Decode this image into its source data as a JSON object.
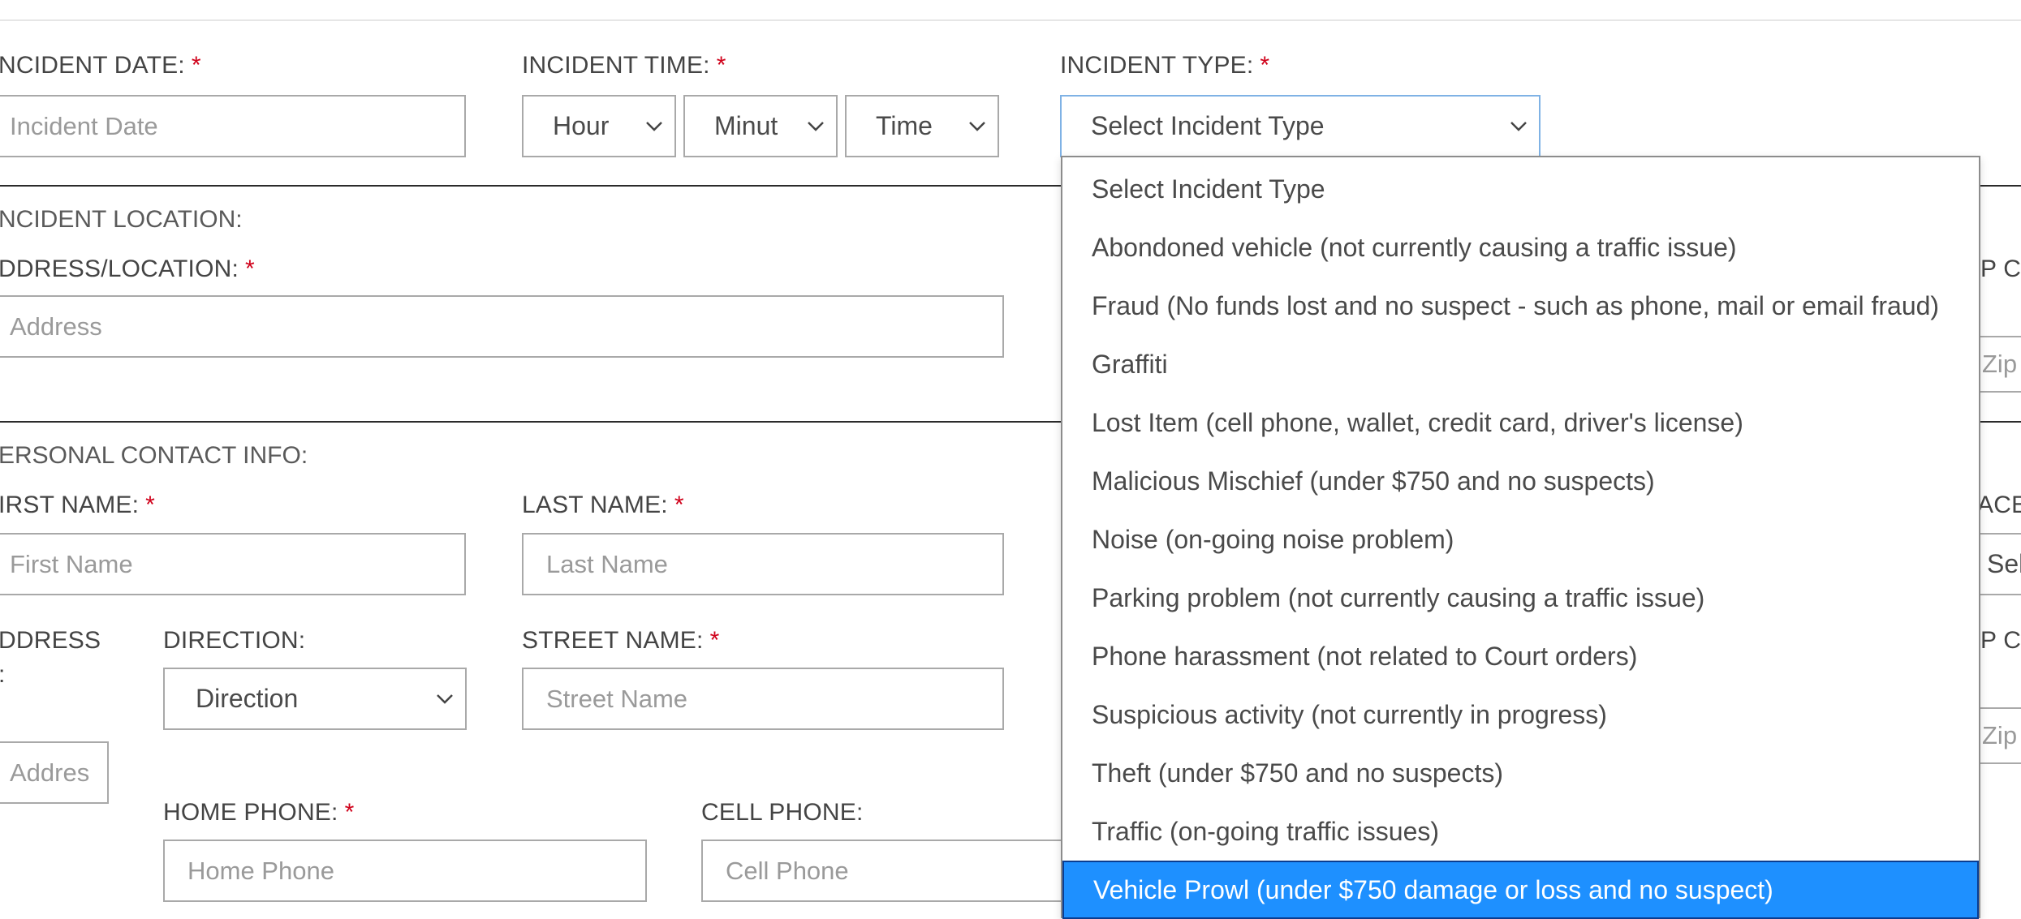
{
  "required_mark": "*",
  "incident": {
    "date_label": "NCIDENT DATE:",
    "date_placeholder": "Incident Date",
    "time_label": "INCIDENT TIME:",
    "hour_value": "Hour",
    "minute_value": "Minut",
    "ampm_value": "Time",
    "type_label": "INCIDENT TYPE:",
    "type_value": "Select Incident Type"
  },
  "location": {
    "section_title": "NCIDENT LOCATION:",
    "address_label": "DDRESS/LOCATION:",
    "address_placeholder": "Address",
    "zip_label_partial": "P CO",
    "zip_placeholder_partial": "Zip"
  },
  "contact": {
    "section_title": "ERSONAL CONTACT INFO:",
    "first_name_label": "IRST NAME:",
    "first_name_placeholder": "First Name",
    "last_name_label": "LAST NAME:",
    "last_name_placeholder": "Last Name",
    "race_label_partial": "ACE:",
    "race_select_partial": "Sel",
    "address_label_line1": "DDRESS",
    "address_label_line2": ":",
    "address_number_placeholder": "Addres",
    "direction_label": "DIRECTION:",
    "direction_value": "Direction",
    "street_label": "STREET NAME:",
    "street_placeholder": "Street Name",
    "zip_label_partial": "P CO",
    "zip_placeholder_partial": "Zip",
    "home_phone_label": "HOME PHONE:",
    "home_phone_placeholder": "Home Phone",
    "cell_phone_label": "CELL PHONE:",
    "cell_phone_placeholder": "Cell Phone"
  },
  "incident_type_options": [
    "Select Incident Type",
    "Abondoned vehicle (not currently causing a traffic issue)",
    "Fraud (No funds lost and no suspect - such as phone, mail or email fraud)",
    "Graffiti",
    "Lost Item (cell phone, wallet, credit card, driver's license)",
    "Malicious Mischief (under $750 and no suspects)",
    "Noise (on-going noise problem)",
    "Parking problem (not currently causing a traffic issue)",
    "Phone harassment (not related to Court orders)",
    "Suspicious activity (not currently in progress)",
    "Theft (under $750 and no suspects)",
    "Traffic (on-going traffic issues)",
    "Vehicle Prowl (under $750 damage or loss and no suspect)"
  ],
  "highlighted_option_index": 12,
  "colors": {
    "required": "#d0021b",
    "highlight": "#1e90ff",
    "focus_border": "#7fb2e5"
  },
  "icons": {
    "select_arrow": "chevron-down-icon"
  }
}
